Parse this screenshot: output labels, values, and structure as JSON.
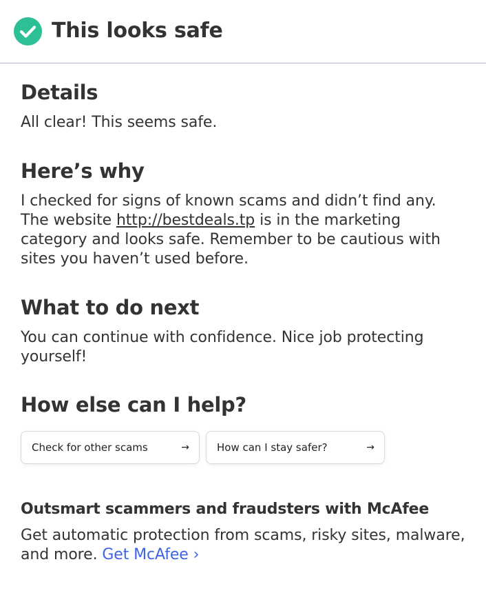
{
  "header": {
    "icon": "check-circle-icon",
    "title": "This looks safe",
    "accent_color": "#2dbf96"
  },
  "details": {
    "heading": "Details",
    "text": "All clear! This seems safe."
  },
  "why": {
    "heading": "Here’s why",
    "text_before": "I checked for signs of known scams and didn’t find any. The website ",
    "link": "http://bestdeals.tp",
    "text_after": " is in the marketing category and looks safe. Remember to be cautious with sites you haven’t used before."
  },
  "next": {
    "heading": "What to do next",
    "text": "You can continue with confidence. Nice job protecting yourself!"
  },
  "help": {
    "heading": "How else can I help?",
    "chips": [
      {
        "label": "Check for other scams",
        "icon": "arrow-right-icon"
      },
      {
        "label": "How can I stay safer?",
        "icon": "arrow-right-icon"
      }
    ]
  },
  "promo": {
    "heading": "Outsmart scammers and fraudsters with McAfee",
    "text": "Get automatic protection from scams, risky sites, malware, and more. ",
    "link": "Get McAfee ›",
    "link_color": "#3d63e6"
  }
}
